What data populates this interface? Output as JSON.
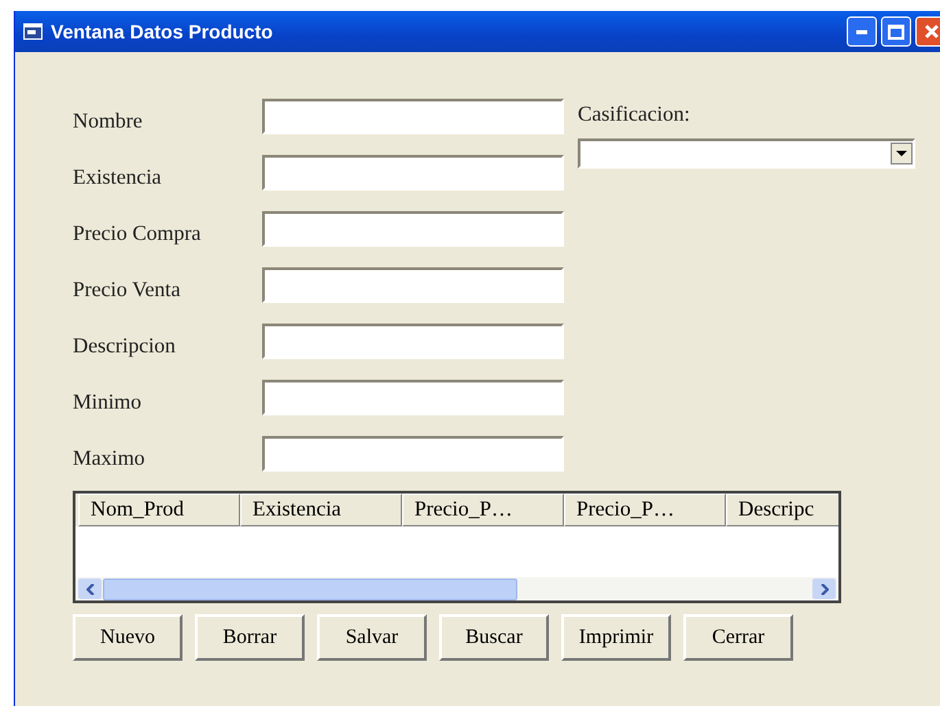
{
  "window": {
    "title": "Ventana Datos Producto"
  },
  "fields": [
    {
      "label": "Nombre"
    },
    {
      "label": "Existencia"
    },
    {
      "label": "Precio Compra"
    },
    {
      "label": "Precio Venta"
    },
    {
      "label": "Descripcion"
    },
    {
      "label": "Minimo"
    },
    {
      "label": "Maximo"
    }
  ],
  "classification": {
    "label": "Casificacion:"
  },
  "grid": {
    "columns": [
      "Nom_Prod",
      "Existencia",
      "Precio_P…",
      "Precio_P…",
      "Descripc"
    ]
  },
  "buttons": [
    "Nuevo",
    "Borrar",
    "Salvar",
    "Buscar",
    "Imprimir",
    "Cerrar"
  ]
}
